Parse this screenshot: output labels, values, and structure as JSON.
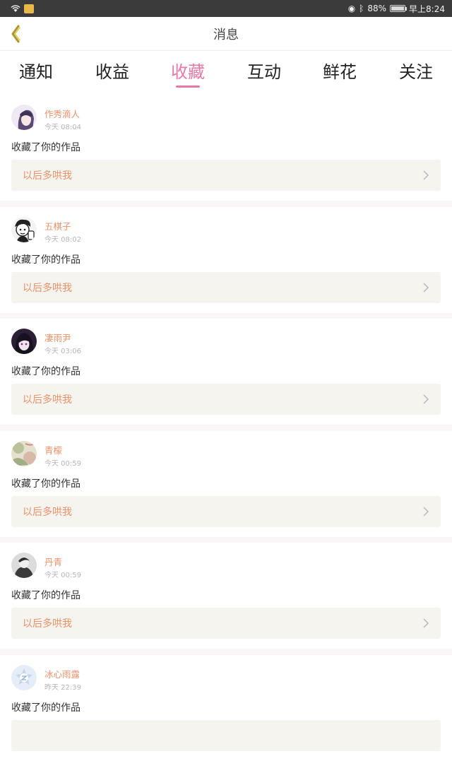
{
  "status_bar": {
    "battery": "88%",
    "time": "早上8:24",
    "battery_level": 0.88
  },
  "nav": {
    "title": "消息"
  },
  "tabs": [
    {
      "label": "通知",
      "active": false
    },
    {
      "label": "收益",
      "active": false
    },
    {
      "label": "收藏",
      "active": true
    },
    {
      "label": "互动",
      "active": false
    },
    {
      "label": "鲜花",
      "active": false
    },
    {
      "label": "关注",
      "active": false
    }
  ],
  "colors": {
    "accent": "#e878a8",
    "username": "#e8926a",
    "work_box_bg": "#f5f4ee"
  },
  "items": [
    {
      "user": "作秀滴人",
      "time": "今天 08:04",
      "action": "收藏了你的作品",
      "work": "以后多哄我"
    },
    {
      "user": "五棋子",
      "time": "今天 08:02",
      "action": "收藏了你的作品",
      "work": "以后多哄我"
    },
    {
      "user": "凄雨尹",
      "time": "今天 03:06",
      "action": "收藏了你的作品",
      "work": "以后多哄我"
    },
    {
      "user": "青檬",
      "time": "今天 00:59",
      "action": "收藏了你的作品",
      "work": "以后多哄我"
    },
    {
      "user": "丹青",
      "time": "今天 00:59",
      "action": "收藏了你的作品",
      "work": "以后多哄我"
    },
    {
      "user": "冰心雨露",
      "time": "昨天 22:39",
      "action": "收藏了你的作品",
      "work": ""
    }
  ]
}
